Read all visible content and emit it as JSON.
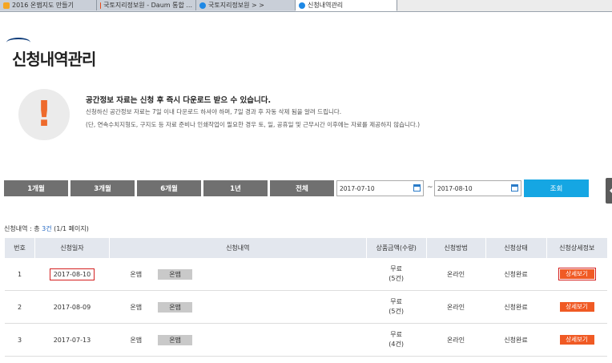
{
  "browser": {
    "tabs": [
      {
        "label": "2016 온맵지도 만들기",
        "color": "#f5a623"
      },
      {
        "label": "국토지리정보원 - Daum 통합 ...",
        "color": "#e64a19"
      },
      {
        "label": "국토지리정보원 > >",
        "color": "#1e88e5"
      },
      {
        "label": "신청내역관리",
        "color": "#1e88e5"
      }
    ]
  },
  "page": {
    "title": "신청내역관리"
  },
  "notice": {
    "icon": "exclamation-icon",
    "symbol": "!",
    "headline": "공간정보 자료는 신청 후 즉시 다운로드 받으 수 있습니다.",
    "line1": "신청하신 공간정보 자료는 7일 이내 다운로드 하셔야 하며, 7일 경과 후 자동 삭제 됨을 알려 드립니다.",
    "line2": "(단, 연속수치지형도, 구지도 등 자료 준비나 인쇄작업이 필요한 경우 토, 일, 공휴일 및 근무시간 이후에는 자료를 제공하지 않습니다.)"
  },
  "filters": {
    "periods": [
      "1개월",
      "3개월",
      "6개월",
      "1년",
      "전체"
    ],
    "start_date": "2017-07-10",
    "end_date": "2017-08-10",
    "separator": "~",
    "search_label": "조회"
  },
  "summary": {
    "prefix": "신청내역 : 총 ",
    "count": "3건",
    "suffix": " (1/1 페이지)"
  },
  "table": {
    "headers": [
      "번호",
      "신청일자",
      "신청내역",
      "상품금액(수량)",
      "신청방법",
      "신청상태",
      "신청상세정보"
    ],
    "rows": [
      {
        "no": "1",
        "date": "2017-08-10",
        "item": "온맵",
        "tag": "온맵",
        "price": "무료",
        "qty": "(5건)",
        "method": "온라인",
        "status": "신청완료",
        "detail": "상세보기"
      },
      {
        "no": "2",
        "date": "2017-08-09",
        "item": "온맵",
        "tag": "온맵",
        "price": "무료",
        "qty": "(5건)",
        "method": "온라인",
        "status": "신청완료",
        "detail": "상세보기"
      },
      {
        "no": "3",
        "date": "2017-07-13",
        "item": "온맵",
        "tag": "온맵",
        "price": "무료",
        "qty": "(4건)",
        "method": "온라인",
        "status": "신청완료",
        "detail": "상세보기"
      }
    ]
  },
  "colors": {
    "accent": "#15a6e3",
    "detail_button": "#f05a24",
    "highlight": "#d42020"
  }
}
